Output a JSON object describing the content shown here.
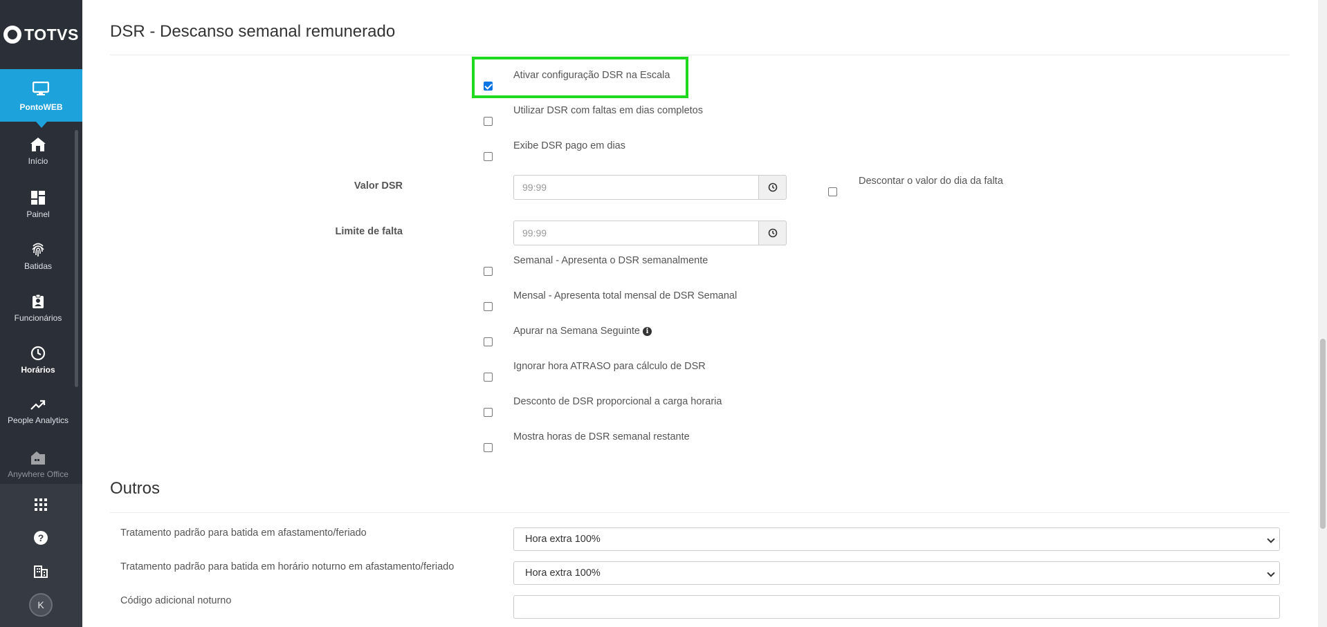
{
  "app": {
    "logo_text": "TOTVS"
  },
  "sidebar": {
    "active": {
      "label": "PontoWEB",
      "icon": "monitor-icon"
    },
    "items": [
      {
        "label": "Início",
        "icon": "home-icon"
      },
      {
        "label": "Painel",
        "icon": "dashboard-icon"
      },
      {
        "label": "Batidas",
        "icon": "fingerprint-icon"
      },
      {
        "label": "Funcionários",
        "icon": "badge-icon"
      },
      {
        "label": "Horários",
        "icon": "clock-icon"
      },
      {
        "label": "People Analytics",
        "icon": "trending-up-icon"
      },
      {
        "label": "Anywhere Office",
        "icon": "office-icon"
      }
    ],
    "bottom": [
      "apps-grid-icon",
      "help-icon",
      "building-icon"
    ],
    "avatar_initial": "K"
  },
  "dsr": {
    "title": "DSR - Descanso semanal remunerado",
    "options_top": [
      {
        "label": "Ativar configuração DSR na Escala",
        "checked": true
      },
      {
        "label": "Utilizar DSR com faltas em dias completos",
        "checked": false
      },
      {
        "label": "Exibe DSR pago em dias",
        "checked": false
      }
    ],
    "valor_dsr": {
      "label": "Valor DSR",
      "placeholder": "99:99"
    },
    "descontar": {
      "label": "Descontar o valor do dia da falta",
      "checked": false
    },
    "limite_falta": {
      "label": "Limite de falta",
      "placeholder": "99:99"
    },
    "options_bottom": [
      {
        "label": "Semanal - Apresenta o DSR semanalmente",
        "checked": false
      },
      {
        "label": "Mensal - Apresenta total mensal de DSR Semanal",
        "checked": false
      },
      {
        "label": "Apurar na Semana Seguinte",
        "checked": false,
        "info": "i"
      },
      {
        "label": "Ignorar hora ATRASO para cálculo de DSR",
        "checked": false
      },
      {
        "label": "Desconto de DSR proporcional a carga horaria",
        "checked": false
      },
      {
        "label": "Mostra horas de DSR semanal restante",
        "checked": false
      }
    ]
  },
  "outros": {
    "title": "Outros",
    "rows": [
      {
        "label": "Tratamento padrão para batida em afastamento/feriado",
        "value": "Hora extra 100%"
      },
      {
        "label": "Tratamento padrão para batida em horário noturno em afastamento/feriado",
        "value": "Hora extra 100%"
      },
      {
        "label": "Código adicional noturno",
        "value": ""
      }
    ]
  },
  "colors": {
    "sidebar_bg": "#2b2f37",
    "active_bg": "#1ea2dc",
    "highlight": "#1ed91e",
    "checkbox_checked": "#0b74e5"
  }
}
